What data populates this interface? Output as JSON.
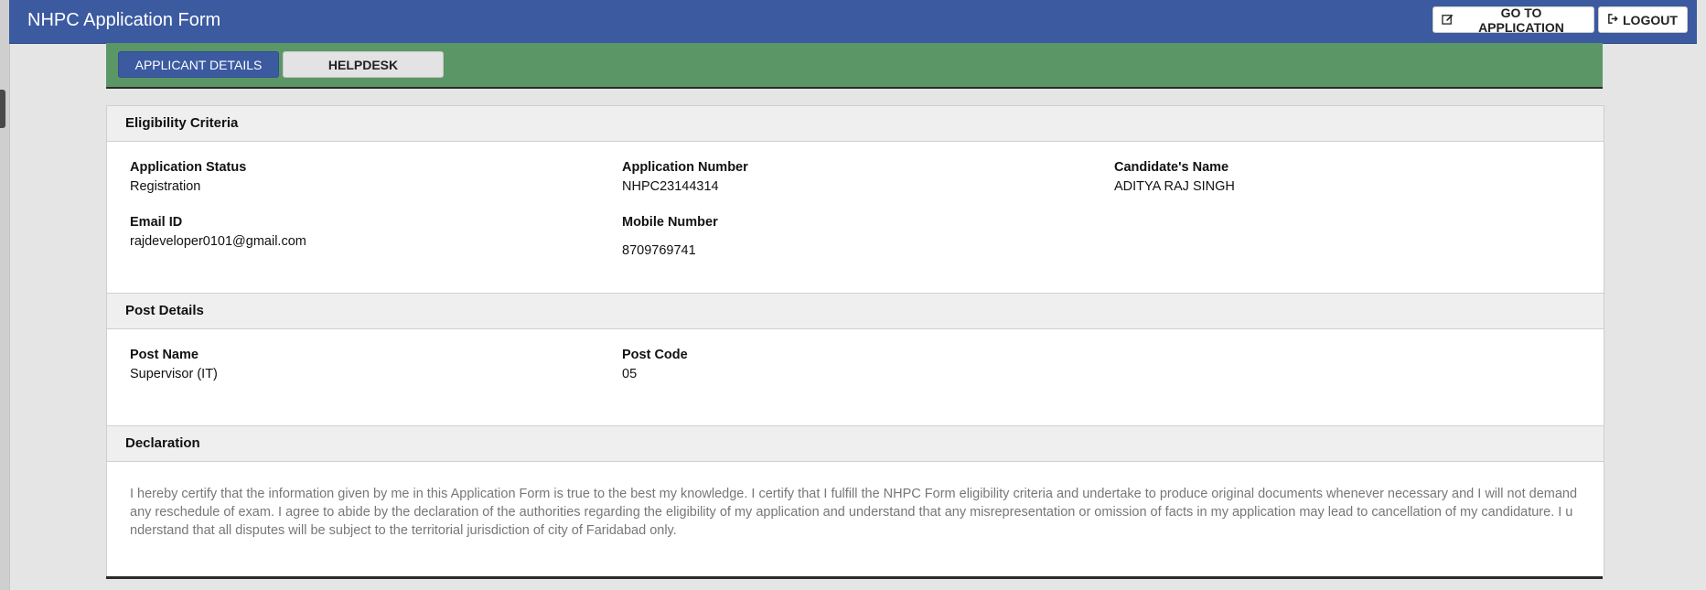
{
  "header": {
    "title": "NHPC Application Form",
    "goto_label": "GO TO APPLICATION",
    "logout_label": "LOGOUT"
  },
  "tabs": [
    {
      "label": "APPLICANT DETAILS",
      "active": true
    },
    {
      "label": "HELPDESK",
      "active": false
    }
  ],
  "eligibility": {
    "title": "Eligibility Criteria",
    "status_label": "Application Status",
    "status_value": "Registration",
    "number_label": "Application Number",
    "number_value": "NHPC23144314",
    "name_label": "Candidate's Name",
    "name_value": "ADITYA RAJ SINGH",
    "email_label": "Email ID",
    "email_value": "rajdeveloper0101@gmail.com",
    "mobile_label": "Mobile Number",
    "mobile_value": "8709769741"
  },
  "post": {
    "title": "Post Details",
    "name_label": "Post Name",
    "name_value": "Supervisor (IT)",
    "code_label": "Post Code",
    "code_value": "05"
  },
  "declaration": {
    "title": "Declaration",
    "text": "I hereby certify that the information given by me in this Application Form is true to the best my knowledge. I certify that I fulfill the NHPC Form eligibility criteria and undertake to produce original documents whenever necessary and I will not demand any reschedule of exam. I agree to abide by the declaration of the authorities regarding the eligibility of my application and understand that any misrepresentation or omission of facts in my application may lead to cancellation of my candidature. I understand that all disputes will be subject to the territorial jurisdiction of city of Faridabad only."
  },
  "colors": {
    "header_blue": "#3b5aa0",
    "tabbar_green": "#5b9667"
  },
  "icons": {
    "goto": "edit-icon",
    "logout": "sign-out-icon"
  }
}
